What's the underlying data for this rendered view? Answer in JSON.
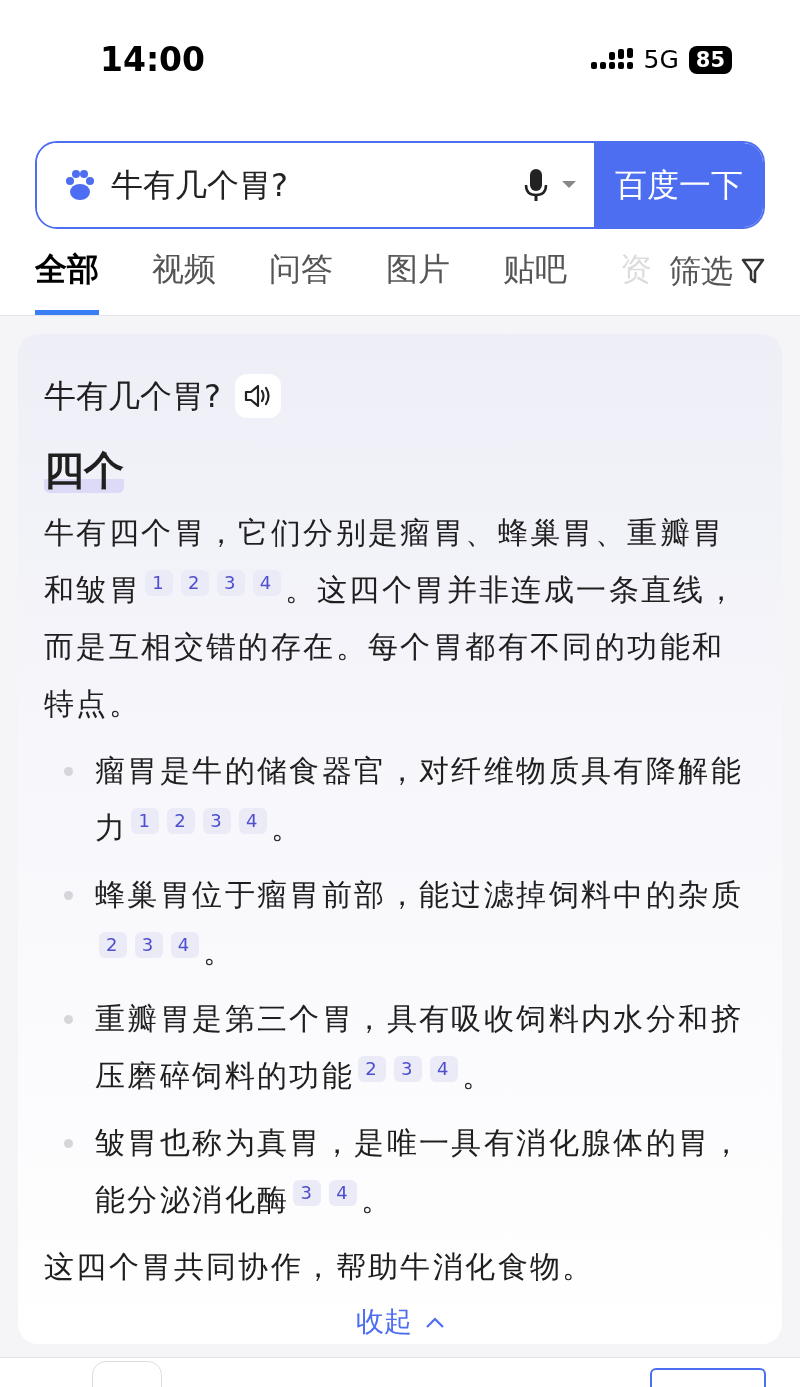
{
  "status_bar": {
    "time": "14:00",
    "network": "5G",
    "battery": "85"
  },
  "search": {
    "value": "牛有几个胃?",
    "button": "百度一下"
  },
  "tabs": [
    {
      "label": "全部",
      "selected": true,
      "faded": false
    },
    {
      "label": "视频",
      "selected": false,
      "faded": false
    },
    {
      "label": "问答",
      "selected": false,
      "faded": false
    },
    {
      "label": "图片",
      "selected": false,
      "faded": false
    },
    {
      "label": "贴吧",
      "selected": false,
      "faded": false
    },
    {
      "label": "资",
      "selected": false,
      "faded": true
    }
  ],
  "filter": {
    "label": "筛选"
  },
  "answer": {
    "question": "牛有几个胃?",
    "headline": "四个",
    "intro": {
      "text": "牛有四个胃，它们分别是瘤胃、蜂巢胃、重瓣胃和皱胃",
      "refs": [
        "1",
        "2",
        "3",
        "4"
      ],
      "tail": "。这四个胃并非连成一条直线，而是互相交错的存在。每个胃都有不同的功能和特点。"
    },
    "bullets": [
      {
        "text": "瘤胃是牛的储食器官，对纤维物质具有降解能力",
        "refs": [
          "1",
          "2",
          "3",
          "4"
        ],
        "tail": "。"
      },
      {
        "text": "蜂巢胃位于瘤胃前部，能过滤掉饲料中的杂质",
        "refs": [
          "2",
          "3",
          "4"
        ],
        "tail": "。"
      },
      {
        "text": "重瓣胃是第三个胃，具有吸收饲料内水分和挤压磨碎饲料的功能",
        "refs": [
          "2",
          "3",
          "4"
        ],
        "tail": "。"
      },
      {
        "text": "皱胃也称为真胃，是唯一具有消化腺体的胃，能分泌消化酶",
        "refs": [
          "3",
          "4"
        ],
        "tail": "。"
      }
    ],
    "conclusion": "这四个胃共同协作，帮助牛消化食物。",
    "collapse": "收起"
  }
}
